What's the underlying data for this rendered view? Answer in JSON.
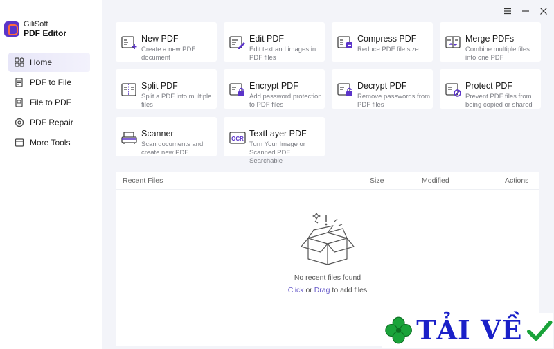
{
  "app": {
    "brand_name": "GiliSoft",
    "product_name": "PDF Editor"
  },
  "colors": {
    "accent": "#5b34c9",
    "logo_orange": "#ff6a3d",
    "link": "#6558c8",
    "background": "#f3f4f9"
  },
  "sidebar": {
    "items": [
      {
        "label": "Home",
        "icon": "home-grid-icon",
        "active": true
      },
      {
        "label": "PDF to File",
        "icon": "pdf-to-file-icon",
        "active": false
      },
      {
        "label": "File to  PDF",
        "icon": "file-to-pdf-icon",
        "active": false
      },
      {
        "label": "PDF Repair",
        "icon": "pdf-repair-icon",
        "active": false
      },
      {
        "label": "More Tools",
        "icon": "more-tools-icon",
        "active": false
      }
    ]
  },
  "window_controls": {
    "menu": "menu-icon",
    "minimize": "minimize-icon",
    "close": "close-icon"
  },
  "tools": [
    {
      "title": "New PDF",
      "desc": "Create a new PDF document",
      "icon": "new-pdf-icon"
    },
    {
      "title": "Edit PDF",
      "desc": "Edit text and images in PDF files",
      "icon": "edit-pdf-icon"
    },
    {
      "title": "Compress PDF",
      "desc": "Reduce PDF file size",
      "icon": "compress-pdf-icon"
    },
    {
      "title": "Merge PDFs",
      "desc": "Combine multiple files into one PDF",
      "icon": "merge-pdfs-icon"
    },
    {
      "title": "Split PDF",
      "desc": "Split a PDF into multiple files",
      "icon": "split-pdf-icon"
    },
    {
      "title": "Encrypt PDF",
      "desc": "Add password protection to PDF files",
      "icon": "encrypt-pdf-icon"
    },
    {
      "title": "Decrypt PDF",
      "desc": "Remove passwords from PDF files",
      "icon": "decrypt-pdf-icon"
    },
    {
      "title": "Protect PDF",
      "desc": "Prevent PDF files from being copied or shared",
      "icon": "protect-pdf-icon"
    },
    {
      "title": "Scanner",
      "desc": "Scan documents and create new PDF",
      "icon": "scanner-icon"
    },
    {
      "title": "TextLayer PDF",
      "desc": "Turn Your Image or Scanned PDF Searchable",
      "icon": "ocr-icon"
    }
  ],
  "recent": {
    "columns": {
      "name": "Recent Files",
      "size": "Size",
      "modified": "Modified",
      "actions": "Actions"
    },
    "empty_message": "No recent files found",
    "click_label": "Click",
    "or_label": "or",
    "drag_label": "Drag",
    "suffix": "to add files"
  },
  "watermark": {
    "text": "TẢI VỀ",
    "color": "#1a20c8"
  }
}
